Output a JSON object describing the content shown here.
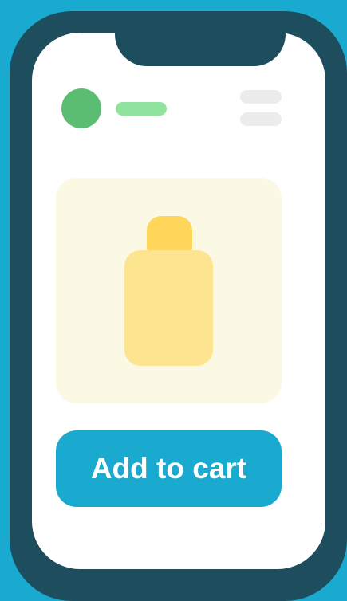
{
  "colors": {
    "background": "#1aa9cf",
    "phone_frame": "#1e4d5d",
    "avatar": "#5bbd72",
    "title_placeholder": "#90e39f",
    "menu_bars": "#ececec",
    "product_card": "#fbf8e3",
    "bottle_cap": "#ffd65a",
    "bottle_body": "#fde48e",
    "button": "#1aa9cf",
    "button_text": "#ffffff"
  },
  "header": {
    "avatar_icon": "avatar-circle",
    "title_icon": "title-placeholder",
    "menu_icon": "menu-icon"
  },
  "product": {
    "image_icon": "bottle-icon"
  },
  "cart": {
    "button_label": "Add to cart"
  }
}
